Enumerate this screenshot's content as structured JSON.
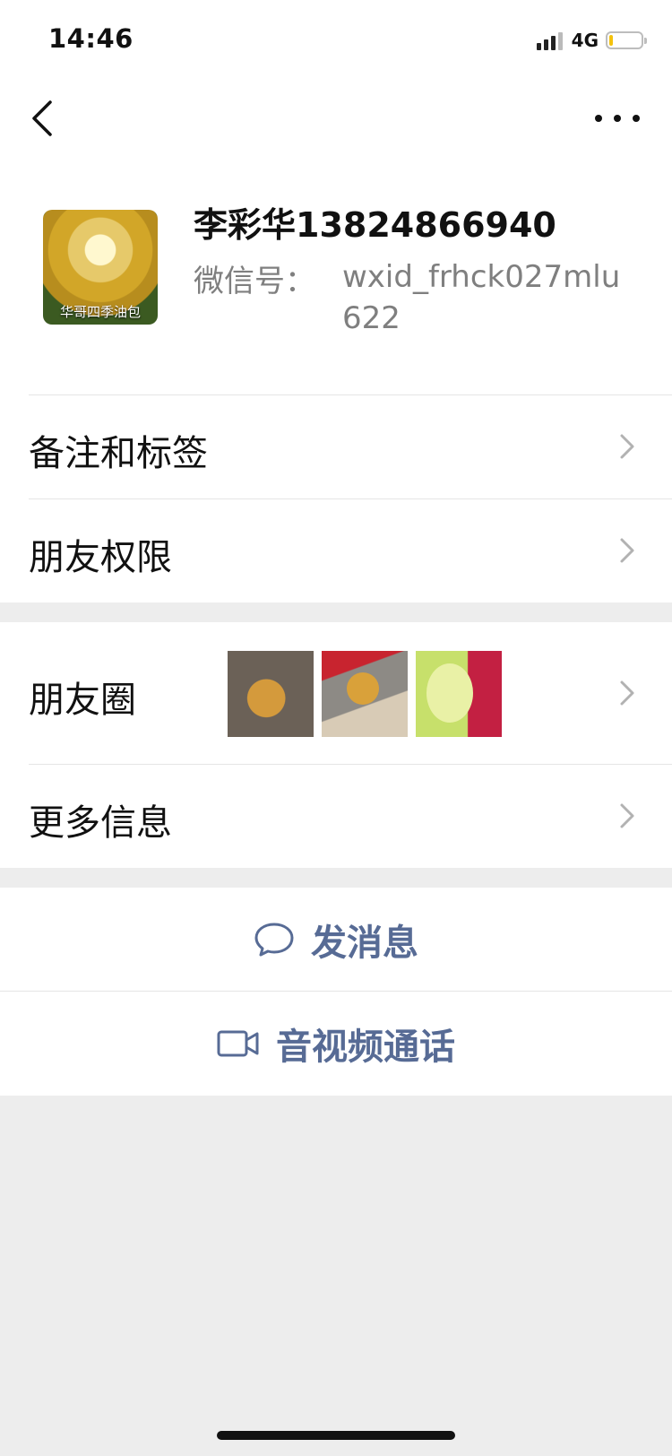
{
  "status_bar": {
    "time": "14:46",
    "network": "4G"
  },
  "profile": {
    "name": "李彩华13824866940",
    "wechat_id_label": "微信号：",
    "wechat_id": "wxid_frhck027mlu622",
    "avatar_caption": "华哥四季油包"
  },
  "menu": {
    "remarks_tags": "备注和标签",
    "friend_permissions": "朋友权限",
    "moments": "朋友圈",
    "more_info": "更多信息"
  },
  "actions": {
    "send_message": "发消息",
    "voice_video_call": "音视频通话"
  },
  "colors": {
    "accent": "#576b95",
    "background": "#ededed"
  },
  "icons": [
    "back-icon",
    "more-icon",
    "chevron-right-icon",
    "chat-bubble-icon",
    "video-camera-icon"
  ]
}
